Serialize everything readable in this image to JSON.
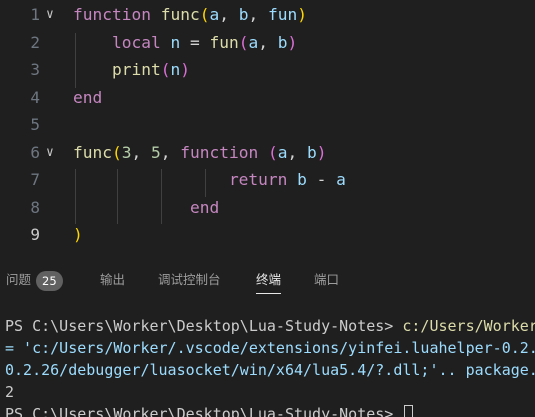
{
  "editor": {
    "lines": [
      {
        "number": "1",
        "tokens": [
          {
            "t": "function",
            "c": "kw"
          },
          {
            "t": " ",
            "c": ""
          },
          {
            "t": "func",
            "c": "fn"
          },
          {
            "t": "(",
            "c": "p1"
          },
          {
            "t": "a",
            "c": "id"
          },
          {
            "t": ", ",
            "c": "op"
          },
          {
            "t": "b",
            "c": "id"
          },
          {
            "t": ", ",
            "c": "op"
          },
          {
            "t": "fun",
            "c": "id"
          },
          {
            "t": ")",
            "c": "p1"
          }
        ]
      },
      {
        "number": "2",
        "tokens": [
          {
            "t": "    ",
            "c": ""
          },
          {
            "t": "local",
            "c": "kw"
          },
          {
            "t": " ",
            "c": ""
          },
          {
            "t": "n",
            "c": "id"
          },
          {
            "t": " = ",
            "c": "op"
          },
          {
            "t": "fun",
            "c": "fn"
          },
          {
            "t": "(",
            "c": "p2"
          },
          {
            "t": "a",
            "c": "id"
          },
          {
            "t": ", ",
            "c": "op"
          },
          {
            "t": "b",
            "c": "id"
          },
          {
            "t": ")",
            "c": "p2"
          }
        ]
      },
      {
        "number": "3",
        "tokens": [
          {
            "t": "    ",
            "c": ""
          },
          {
            "t": "print",
            "c": "fn"
          },
          {
            "t": "(",
            "c": "p2"
          },
          {
            "t": "n",
            "c": "id"
          },
          {
            "t": ")",
            "c": "p2"
          }
        ]
      },
      {
        "number": "4",
        "tokens": [
          {
            "t": "end",
            "c": "kw"
          }
        ]
      },
      {
        "number": "5",
        "tokens": []
      },
      {
        "number": "6",
        "tokens": [
          {
            "t": "func",
            "c": "fn"
          },
          {
            "t": "(",
            "c": "p1"
          },
          {
            "t": "3",
            "c": "num"
          },
          {
            "t": ", ",
            "c": "op"
          },
          {
            "t": "5",
            "c": "num"
          },
          {
            "t": ", ",
            "c": "op"
          },
          {
            "t": "function",
            "c": "kw"
          },
          {
            "t": " ",
            "c": ""
          },
          {
            "t": "(",
            "c": "p2"
          },
          {
            "t": "a",
            "c": "id"
          },
          {
            "t": ", ",
            "c": "op"
          },
          {
            "t": "b",
            "c": "id"
          },
          {
            "t": ")",
            "c": "p2"
          }
        ]
      },
      {
        "number": "7",
        "tokens": [
          {
            "t": "                ",
            "c": ""
          },
          {
            "t": "return",
            "c": "kw"
          },
          {
            "t": " ",
            "c": ""
          },
          {
            "t": "b",
            "c": "id"
          },
          {
            "t": " - ",
            "c": "op"
          },
          {
            "t": "a",
            "c": "id"
          }
        ]
      },
      {
        "number": "8",
        "tokens": [
          {
            "t": "            ",
            "c": ""
          },
          {
            "t": "end",
            "c": "kw"
          }
        ]
      },
      {
        "number": "9",
        "tokens": [
          {
            "t": ")",
            "c": "p1"
          }
        ]
      }
    ],
    "active_line": "9"
  },
  "panel": {
    "tabs": [
      {
        "label": "问题",
        "badge": "25"
      },
      {
        "label": "输出"
      },
      {
        "label": "调试控制台"
      },
      {
        "label": "终端",
        "active": true
      },
      {
        "label": "端口"
      }
    ]
  },
  "terminal": {
    "line1_prompt": "PS C:\\Users\\Worker\\Desktop\\Lua-Study-Notes> ",
    "line1_cmd": "c:/Users/Worker",
    "line2": "= 'c:/Users/Worker/.vscode/extensions/yinfei.luahelper-0.2.",
    "line3": "0.2.26/debugger/luasocket/win/x64/lua5.4/?.dll;'.. package.",
    "line4": "2",
    "line5_prompt": "PS C:\\Users\\Worker\\Desktop\\Lua-Study-Notes> "
  },
  "colors": {
    "background": "#1f1f1f",
    "keyword": "#c586c0",
    "function": "#dcdcaa",
    "identifier": "#9cdcfe",
    "number": "#b5cea8",
    "bracket_level1": "#ffd700",
    "bracket_level2": "#da70d6"
  }
}
